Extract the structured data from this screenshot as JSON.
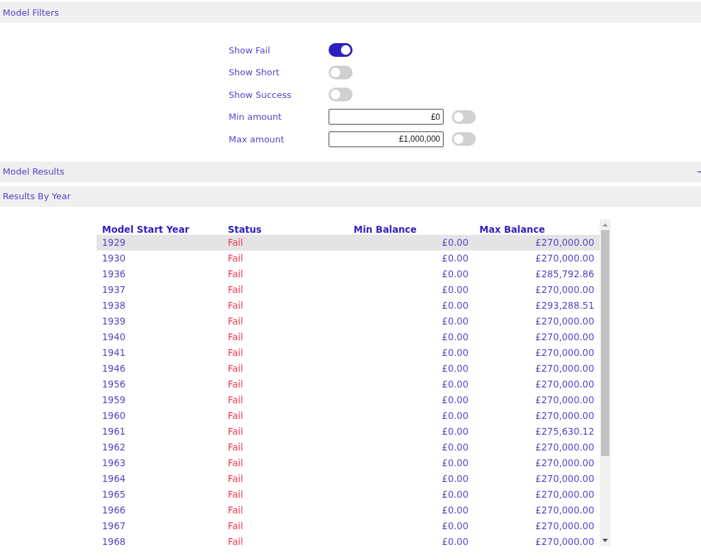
{
  "sections": [
    {
      "title": "Model Filters"
    },
    {
      "title": "Model Results"
    },
    {
      "title": "Results By Year"
    }
  ],
  "filters": [
    {
      "kind": "toggle",
      "label": "Show Fail",
      "on": true
    },
    {
      "kind": "toggle",
      "label": "Show Short",
      "on": false
    },
    {
      "kind": "toggle",
      "label": "Show Success",
      "on": false
    },
    {
      "kind": "amount",
      "label": "Min amount",
      "value": "£0",
      "on": false
    },
    {
      "kind": "amount",
      "label": "Max amount",
      "value": "£1,000,000",
      "on": false
    }
  ],
  "table": {
    "columns": [
      "Model Start Year",
      "Status",
      "Min Balance",
      "Max Balance"
    ],
    "rows": [
      {
        "year": "1929",
        "status": "Fail",
        "min": "£0.00",
        "max": "£270,000.00",
        "selected": true
      },
      {
        "year": "1930",
        "status": "Fail",
        "min": "£0.00",
        "max": "£270,000.00",
        "selected": false
      },
      {
        "year": "1936",
        "status": "Fail",
        "min": "£0.00",
        "max": "£285,792.86",
        "selected": false
      },
      {
        "year": "1937",
        "status": "Fail",
        "min": "£0.00",
        "max": "£270,000.00",
        "selected": false
      },
      {
        "year": "1938",
        "status": "Fail",
        "min": "£0.00",
        "max": "£293,288.51",
        "selected": false
      },
      {
        "year": "1939",
        "status": "Fail",
        "min": "£0.00",
        "max": "£270,000.00",
        "selected": false
      },
      {
        "year": "1940",
        "status": "Fail",
        "min": "£0.00",
        "max": "£270,000.00",
        "selected": false
      },
      {
        "year": "1941",
        "status": "Fail",
        "min": "£0.00",
        "max": "£270,000.00",
        "selected": false
      },
      {
        "year": "1946",
        "status": "Fail",
        "min": "£0.00",
        "max": "£270,000.00",
        "selected": false
      },
      {
        "year": "1956",
        "status": "Fail",
        "min": "£0.00",
        "max": "£270,000.00",
        "selected": false
      },
      {
        "year": "1959",
        "status": "Fail",
        "min": "£0.00",
        "max": "£270,000.00",
        "selected": false
      },
      {
        "year": "1960",
        "status": "Fail",
        "min": "£0.00",
        "max": "£270,000.00",
        "selected": false
      },
      {
        "year": "1961",
        "status": "Fail",
        "min": "£0.00",
        "max": "£275,630.12",
        "selected": false
      },
      {
        "year": "1962",
        "status": "Fail",
        "min": "£0.00",
        "max": "£270,000.00",
        "selected": false
      },
      {
        "year": "1963",
        "status": "Fail",
        "min": "£0.00",
        "max": "£270,000.00",
        "selected": false
      },
      {
        "year": "1964",
        "status": "Fail",
        "min": "£0.00",
        "max": "£270,000.00",
        "selected": false
      },
      {
        "year": "1965",
        "status": "Fail",
        "min": "£0.00",
        "max": "£270,000.00",
        "selected": false
      },
      {
        "year": "1966",
        "status": "Fail",
        "min": "£0.00",
        "max": "£270,000.00",
        "selected": false
      },
      {
        "year": "1967",
        "status": "Fail",
        "min": "£0.00",
        "max": "£270,000.00",
        "selected": false
      },
      {
        "year": "1968",
        "status": "Fail",
        "min": "£0.00",
        "max": "£270,000.00",
        "selected": false
      }
    ]
  }
}
